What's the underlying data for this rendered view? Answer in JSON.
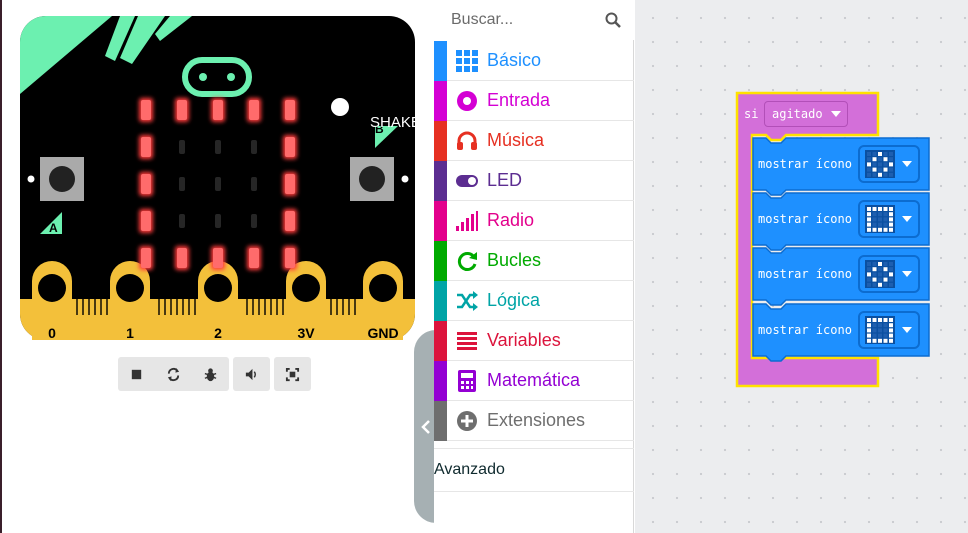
{
  "simulator": {
    "shake_label": "SHAKE",
    "button_a_label": "A",
    "button_b_label": "B",
    "pins": [
      "0",
      "1",
      "2",
      "3V",
      "GND"
    ],
    "led_matrix": [
      [
        1,
        1,
        1,
        1,
        1
      ],
      [
        1,
        0,
        0,
        0,
        1
      ],
      [
        1,
        0,
        0,
        0,
        1
      ],
      [
        1,
        0,
        0,
        0,
        1
      ],
      [
        1,
        1,
        1,
        1,
        1
      ]
    ],
    "toolbar": [
      {
        "icon": "stop-icon"
      },
      {
        "icon": "restart-icon"
      },
      {
        "icon": "debug-icon"
      },
      {
        "icon": "mute-icon"
      },
      {
        "icon": "fullscreen-icon"
      }
    ]
  },
  "toolbox": {
    "search_placeholder": "Buscar...",
    "categories": [
      {
        "label": "Básico",
        "color": "#1e90ff",
        "icon": "grid-icon"
      },
      {
        "label": "Entrada",
        "color": "#d400d4",
        "icon": "input-icon"
      },
      {
        "label": "Música",
        "color": "#e63022",
        "icon": "headphones-icon"
      },
      {
        "label": "LED",
        "color": "#5c2d91",
        "icon": "toggle-icon"
      },
      {
        "label": "Radio",
        "color": "#e3008c",
        "icon": "signal-icon"
      },
      {
        "label": "Bucles",
        "color": "#00aa00",
        "icon": "loop-icon"
      },
      {
        "label": "Lógica",
        "color": "#00a4a6",
        "icon": "shuffle-icon"
      },
      {
        "label": "Variables",
        "color": "#dc143c",
        "icon": "list-icon"
      },
      {
        "label": "Matemática",
        "color": "#9400d3",
        "icon": "calculator-icon"
      },
      {
        "label": "Extensiones",
        "color": "#6e6e6e",
        "icon": "plus-circle-icon"
      }
    ],
    "advanced": {
      "label": "Avanzado",
      "color": "#0f2a2e",
      "icon": "chevron-down-icon"
    }
  },
  "workspace": {
    "event_block": {
      "keyword": "si",
      "gesture": "agitado",
      "color": "#d36fd9"
    },
    "show_blocks": [
      {
        "label": "mostrar ícono",
        "icon_pattern": "diamond"
      },
      {
        "label": "mostrar ícono",
        "icon_pattern": "square"
      },
      {
        "label": "mostrar ícono",
        "icon_pattern": "diamond"
      },
      {
        "label": "mostrar ícono",
        "icon_pattern": "square"
      }
    ]
  }
}
